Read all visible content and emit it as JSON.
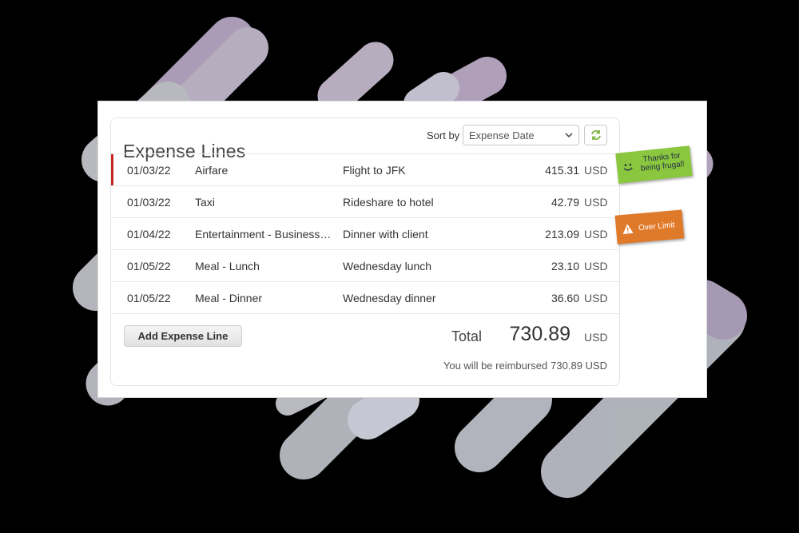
{
  "header": {
    "title": "Expense Lines",
    "sort_label": "Sort by",
    "sort_value": "Expense Date",
    "refresh_icon": "refresh-icon"
  },
  "rows": [
    {
      "date": "01/03/22",
      "type": "Airfare",
      "description": "Flight to JFK",
      "amount": "415.31",
      "currency": "USD",
      "flagged": true
    },
    {
      "date": "01/03/22",
      "type": "Taxi",
      "description": "Rideshare to hotel",
      "amount": "42.79",
      "currency": "USD",
      "flagged": false
    },
    {
      "date": "01/04/22",
      "type": "Entertainment - Business Meal",
      "description": "Dinner with client",
      "amount": "213.09",
      "currency": "USD",
      "flagged": false
    },
    {
      "date": "01/05/22",
      "type": "Meal - Lunch",
      "description": "Wednesday lunch",
      "amount": "23.10",
      "currency": "USD",
      "flagged": false
    },
    {
      "date": "01/05/22",
      "type": "Meal - Dinner",
      "description": "Wednesday dinner",
      "amount": "36.60",
      "currency": "USD",
      "flagged": false
    }
  ],
  "footer": {
    "add_button": "Add Expense Line",
    "total_label": "Total",
    "total_value": "730.89",
    "total_currency": "USD",
    "reimburse_text": "You will be reimbursed",
    "reimburse_amount": "730.89 USD"
  },
  "notes": {
    "frugal": "Thanks for being frugal!",
    "over_limit": "Over Limit"
  },
  "colors": {
    "flag": "#c62828",
    "note_green": "#8bc63f",
    "note_orange": "#e07a2b"
  }
}
